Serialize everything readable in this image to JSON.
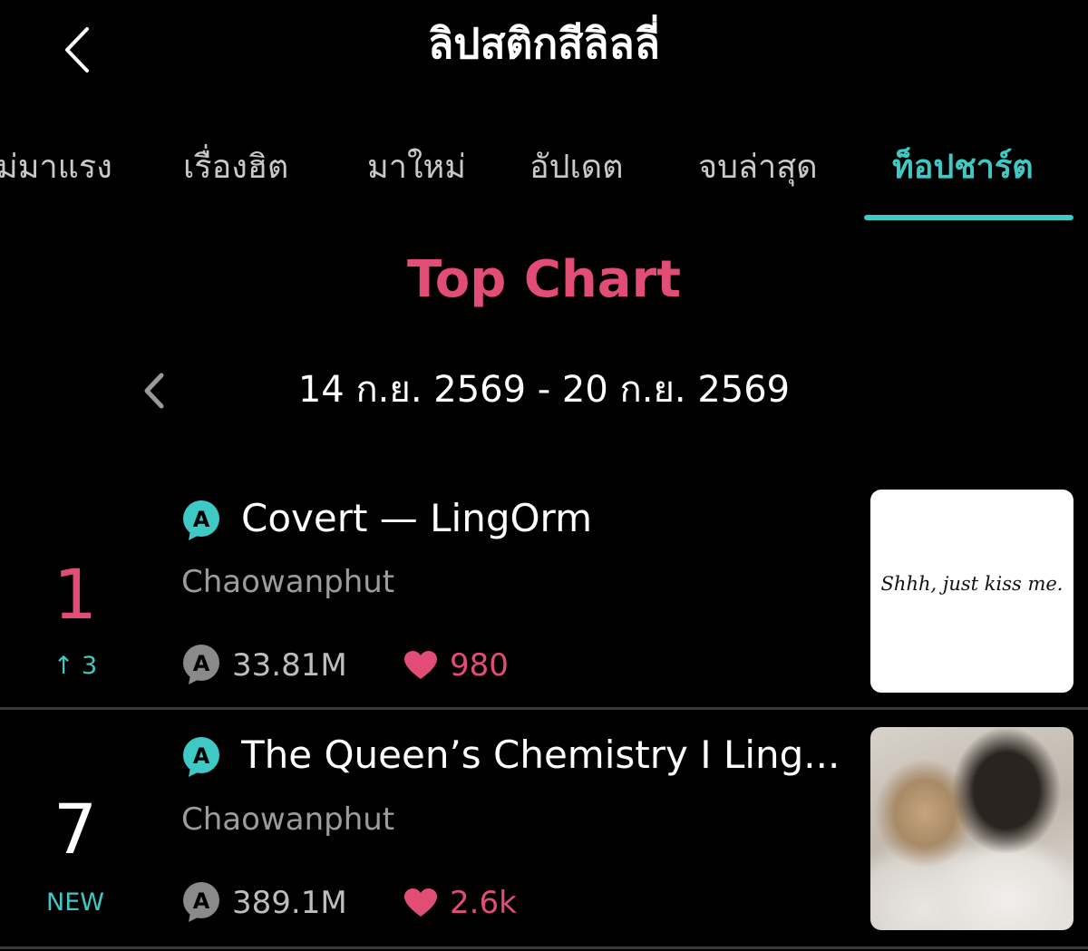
{
  "header": {
    "title": "ลิปสติกสีลิลลี่",
    "back_icon": "chevron-left-icon"
  },
  "tabs": [
    {
      "label": "ม่มาแรง",
      "active": false
    },
    {
      "label": "เรื่องฮิต",
      "active": false
    },
    {
      "label": "มาใหม่",
      "active": false
    },
    {
      "label": "อัปเดต",
      "active": false
    },
    {
      "label": "จบล่าสุด",
      "active": false
    },
    {
      "label": "ท็อปชาร์ต",
      "active": true
    }
  ],
  "chart": {
    "title": "Top Chart",
    "date_range": "14 ก.ย. 2569 - 20 ก.ย. 2569",
    "prev_icon": "chevron-left-icon"
  },
  "items": [
    {
      "rank": "1",
      "rank_change": "↑ 3",
      "badge": "A",
      "title": "Covert — LingOrm",
      "author": "Chaowanphut",
      "views": "33.81M",
      "likes": "980",
      "cover_text": "Shhh, just kiss me."
    },
    {
      "rank": "7",
      "rank_change": "NEW",
      "badge": "A",
      "title": "The Queen’s Chemistry I Ling...",
      "author": "Chaowanphut",
      "views": "389.1M",
      "likes": "2.6k"
    }
  ],
  "colors": {
    "accent_teal": "#3fc9c5",
    "accent_pink": "#e24d78",
    "background": "#000000"
  }
}
